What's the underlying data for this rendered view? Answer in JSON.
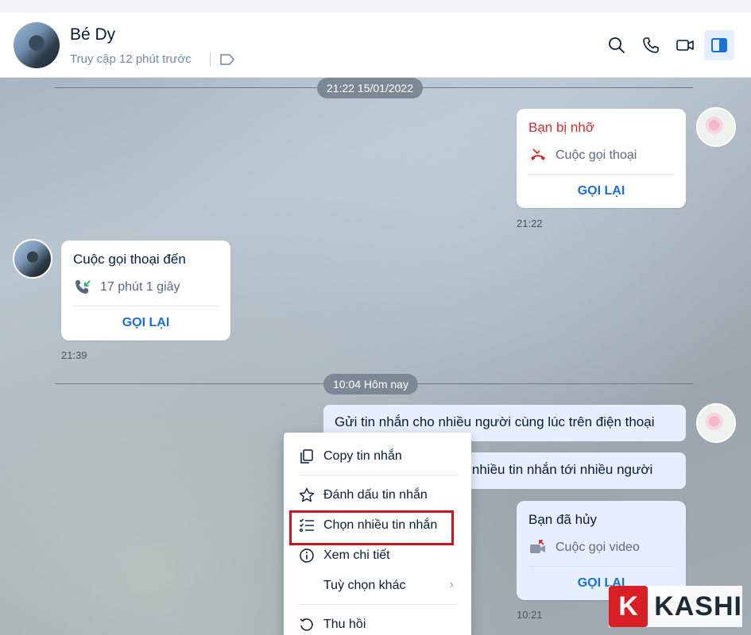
{
  "header": {
    "name": "Bé Dy",
    "status": "Truy cập 12 phút trước",
    "icons": [
      "search-icon",
      "phone-icon",
      "video-icon",
      "sidebar-toggle-icon"
    ]
  },
  "dates": {
    "first": "21:22 15/01/2022",
    "second": "10:04 Hôm nay"
  },
  "messages": {
    "missed_call": {
      "title": "Bạn bị nhỡ",
      "detail": "Cuộc gọi thoại",
      "action": "GỌI LẠI",
      "time": "21:22"
    },
    "incoming_call": {
      "title": "Cuộc gọi thoại đến",
      "detail": "17 phút 1 giây",
      "action": "GỌI LẠI",
      "time": "21:39"
    },
    "text1": "Gửi tin nhắn cho nhiều người cùng lúc trên điện thoại",
    "text2": "ửi nhiều tin nhắn tới nhiều người",
    "cancelled_call": {
      "title": "Bạn đã hủy",
      "detail": "Cuộc gọi video",
      "action": "GỌI LẠI",
      "time": "10:21"
    }
  },
  "context_menu": {
    "copy": "Copy tin nhắn",
    "mark": "Đánh dấu tin nhắn",
    "select_multiple": "Chọn nhiều tin nhắn",
    "details": "Xem chi tiết",
    "more": "Tuỳ chọn khác",
    "recall": "Thu hồi"
  },
  "watermark": {
    "letter": "K",
    "text": "KASHI"
  },
  "colors": {
    "accent": "#1a6fd9",
    "missed": "#d02b34",
    "highlight": "#d0141f",
    "my_bubble": "#e5efff"
  }
}
